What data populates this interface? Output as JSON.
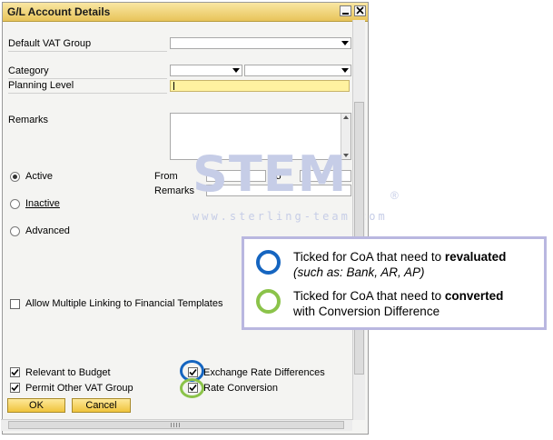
{
  "window": {
    "title": "G/L Account Details"
  },
  "fields": {
    "default_vat_group": "Default VAT Group",
    "category": "Category",
    "planning_level": "Planning Level",
    "remarks": "Remarks"
  },
  "status": {
    "active": "Active",
    "inactive": "Inactive",
    "advanced": "Advanced",
    "selected": "Active",
    "from_label": "From",
    "to_label": "To",
    "remarks_label": "Remarks"
  },
  "checkboxes": {
    "allow_multiple_linking": {
      "label": "Allow Multiple Linking to Financial Templates",
      "checked": false
    },
    "relevant_to_budget": {
      "label": "Relevant to Budget",
      "checked": true
    },
    "permit_other_vat_group": {
      "label": "Permit Other VAT Group",
      "checked": true
    },
    "exchange_rate_differences": {
      "label": "Exchange Rate Differences",
      "checked": true
    },
    "rate_conversion": {
      "label": "Rate Conversion",
      "checked": true
    }
  },
  "buttons": {
    "ok": "OK",
    "cancel": "Cancel"
  },
  "watermark": {
    "brand": "STEM",
    "url": "www.sterling-team.com",
    "registered": "®"
  },
  "legend": {
    "item1": {
      "text": "Ticked for CoA that need to ",
      "bold": "revaluated",
      "sub": "(such as: Bank, AR, AP)"
    },
    "item2": {
      "text": "Ticked for CoA that need to ",
      "bold": "converted",
      "sub": "with Conversion Difference"
    }
  },
  "colors": {
    "blue_ring": "#1565c0",
    "green_ring": "#8bc34a",
    "title_bar": "#f0cf6a",
    "button": "#f4cf4a",
    "planning_field": "#fff2a0"
  }
}
